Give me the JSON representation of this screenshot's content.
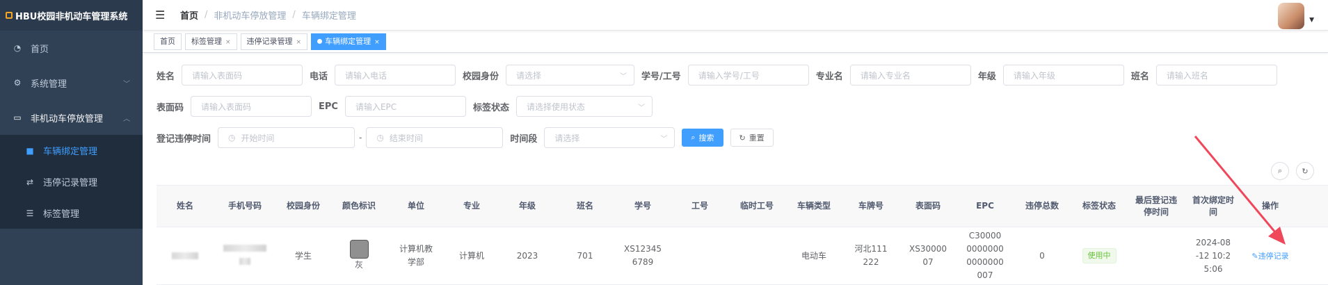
{
  "app": {
    "title": "HBU校园非机动车管理系统"
  },
  "sidebar": {
    "items": [
      {
        "label": "首页",
        "icon": "dashboard-icon"
      },
      {
        "label": "系统管理",
        "icon": "gear-icon"
      },
      {
        "label": "非机动车停放管理",
        "icon": "monitor-icon"
      }
    ],
    "submenu": [
      {
        "label": "车辆绑定管理",
        "icon": "lock-icon",
        "active": true
      },
      {
        "label": "违停记录管理",
        "icon": "swap-icon"
      },
      {
        "label": "标签管理",
        "icon": "list-icon"
      }
    ]
  },
  "navbar": {
    "breadcrumb": [
      "首页",
      "非机动车停放管理",
      "车辆绑定管理"
    ]
  },
  "tags": [
    {
      "label": "首页"
    },
    {
      "label": "标签管理"
    },
    {
      "label": "违停记录管理"
    },
    {
      "label": "车辆绑定管理",
      "active": true
    }
  ],
  "form": {
    "name": {
      "label": "姓名",
      "placeholder": "请输入表面码"
    },
    "phone": {
      "label": "电话",
      "placeholder": "请输入电话"
    },
    "identity": {
      "label": "校园身份",
      "placeholder": "请选择"
    },
    "student_no": {
      "label": "学号/工号",
      "placeholder": "请输入学号/工号"
    },
    "major": {
      "label": "专业名",
      "placeholder": "请输入专业名"
    },
    "grade": {
      "label": "年级",
      "placeholder": "请输入年级"
    },
    "class": {
      "label": "班名",
      "placeholder": "请输入班名"
    },
    "surface_code": {
      "label": "表面码",
      "placeholder": "请输入表面码"
    },
    "epc": {
      "label": "EPC",
      "placeholder": "请输入EPC"
    },
    "tag_status": {
      "label": "标签状态",
      "placeholder": "请选择使用状态"
    },
    "reg_time": {
      "label": "登记违停时间",
      "start": "开始时间",
      "dash": "-",
      "end": "结束时间"
    },
    "period": {
      "label": "时间段",
      "placeholder": "请选择"
    },
    "search_label": "搜索",
    "reset_label": "重置"
  },
  "table": {
    "headers": [
      "姓名",
      "手机号码",
      "校园身份",
      "颜色标识",
      "单位",
      "专业",
      "年级",
      "班名",
      "学号",
      "工号",
      "临时工号",
      "车辆类型",
      "车牌号",
      "表面码",
      "EPC",
      "违停总数",
      "标签状态",
      "最后登记违停时间",
      "首次绑定时间",
      "操作"
    ],
    "rows": [
      {
        "identity": "学生",
        "color": "灰",
        "unit": "计算机教学部",
        "major": "计算机",
        "grade": "2023",
        "class": "701",
        "student_no": "XS123456789",
        "staff_no": "",
        "temp_no": "",
        "vehicle_type": "电动车",
        "plate": "河北111222",
        "surface": "XS3000007",
        "epc": "C3000000000000000000007",
        "violations": "0",
        "status": "使用中",
        "last_time": "",
        "first_time": "2024-08-12 10:25:06",
        "op": "违停记录"
      }
    ]
  },
  "colors": {
    "sidebar_bg": "#304156",
    "accent": "#409eff",
    "success": "#67c23a",
    "annotation_arrow": "#f0485b"
  }
}
